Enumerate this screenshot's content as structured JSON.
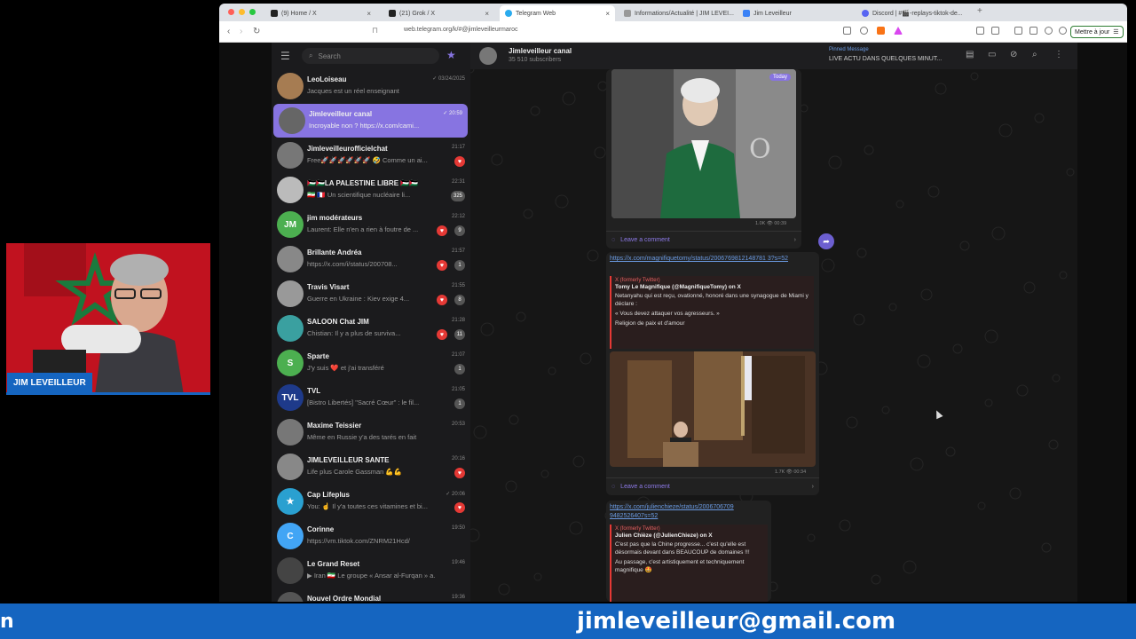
{
  "browser": {
    "tabs": [
      {
        "label": "(9) Home / X",
        "active": false
      },
      {
        "label": "(21) Grok / X",
        "active": false
      },
      {
        "label": "Telegram Web",
        "active": true
      },
      {
        "label": "Informations/Actualité | JIM LEVEI...",
        "active": false
      },
      {
        "label": "Jim Leveilleur",
        "active": false
      },
      {
        "label": "Discord | #🎬-replays-tiktok-de...",
        "active": false
      }
    ],
    "new_tab": "+",
    "url": "web.telegram.org/k/#@jimleveilleurmaroc",
    "update_label": "Mettre à jour"
  },
  "sidebar": {
    "search_placeholder": "Search",
    "chats": [
      {
        "name": "LeoLoiseau",
        "preview": "Jacques est un réel enseignant",
        "time": "✓ 03/24/2025",
        "badge": "",
        "heart": false,
        "avatar_color": "#a67c52",
        "avatar_letter": ""
      },
      {
        "name": "Jimleveilleur canal",
        "preview": "Incroyable non ? https://x.com/cami...",
        "time": "✓ 20:59",
        "badge": "",
        "heart": false,
        "avatar_color": "#666666",
        "avatar_letter": "",
        "active": true
      },
      {
        "name": "Jimleveilleurofficielchat",
        "preview": "Free🚀🚀🚀🚀🚀🚀 🤣 Comme un ai...",
        "time": "21:17",
        "badge": "",
        "heart": true,
        "avatar_color": "#777777",
        "avatar_letter": ""
      },
      {
        "name": "🇵🇸🇵🇸LA PALESTINE LIBRE 🇵🇸🇵🇸",
        "preview": "🇮🇷 🇫🇷 Un scientifique nucléaire li...",
        "time": "22:31",
        "badge": "325",
        "heart": false,
        "avatar_color": "#bbbbbb",
        "avatar_letter": ""
      },
      {
        "name": "jim modérateurs",
        "preview": "Laurent: Elle n'en a rien à foutre de ...",
        "time": "22:12",
        "badge": "9",
        "heart": true,
        "avatar_color": "#4caf50",
        "avatar_letter": "JM"
      },
      {
        "name": "Brillante Andréa",
        "preview": "https://x.com/i/status/200708...",
        "time": "21:57",
        "badge": "1",
        "heart": true,
        "avatar_color": "#888888",
        "avatar_letter": ""
      },
      {
        "name": "Travis Visart",
        "preview": "Guerre en Ukraine : Kiev exige 4...",
        "time": "21:55",
        "badge": "8",
        "heart": true,
        "avatar_color": "#999999",
        "avatar_letter": ""
      },
      {
        "name": "SALOON Chat JIM",
        "preview": "Chistian: Il y a plus de surviva...",
        "time": "21:28",
        "badge": "11",
        "heart": true,
        "avatar_color": "#3aa0a0",
        "avatar_letter": ""
      },
      {
        "name": "Sparte",
        "preview": "J'y suis ❤️ et j'ai transféré",
        "time": "21:07",
        "badge": "1",
        "heart": false,
        "avatar_color": "#4caf50",
        "avatar_letter": "S"
      },
      {
        "name": "TVL",
        "preview": "[Bistro Libertés] \"Sacré Cœur\" : le fil...",
        "time": "21:05",
        "badge": "1",
        "heart": false,
        "avatar_color": "#1e3a8a",
        "avatar_letter": "TVL"
      },
      {
        "name": "Maxime Teissier",
        "preview": "Même en Russie y'a des tarés en fait",
        "time": "20:53",
        "badge": "",
        "heart": false,
        "avatar_color": "#777777",
        "avatar_letter": ""
      },
      {
        "name": "JIMLEVEILLEUR SANTE",
        "preview": "Life plus Carole Gassman 💪💪",
        "time": "20:16",
        "badge": "",
        "heart": true,
        "avatar_color": "#888888",
        "avatar_letter": ""
      },
      {
        "name": "Cap Lifeplus",
        "preview": "You: ☝ Il y'a toutes ces vitamines et bi...",
        "time": "✓ 20:06",
        "badge": "",
        "heart": true,
        "avatar_color": "#2aa0d0",
        "avatar_letter": "★"
      },
      {
        "name": "Corinne",
        "preview": "https://vm.tiktok.com/ZNRM21Hcd/",
        "time": "19:50",
        "badge": "",
        "heart": false,
        "avatar_color": "#42a5f5",
        "avatar_letter": "C"
      },
      {
        "name": "Le Grand Reset",
        "preview": "▶ Iran 🇮🇷 Le groupe « Ansar al-Furqan » a...",
        "time": "19:46",
        "badge": "",
        "heart": false,
        "avatar_color": "#444444",
        "avatar_letter": ""
      },
      {
        "name": "Nouvel Ordre Mondial",
        "preview": "",
        "time": "19:36",
        "badge": "",
        "heart": false,
        "avatar_color": "#555555",
        "avatar_letter": ""
      }
    ]
  },
  "channel": {
    "title": "Jimleveilleur canal",
    "subscribers": "35 510 subscribers",
    "pinned_label": "Pinned Message",
    "pinned_text": "LIVE ACTU DANS QUELQUES MINUT..."
  },
  "messages": [
    {
      "badge": "Today",
      "views": "1.0K",
      "time": "00:39",
      "comment_label": "Leave a comment"
    },
    {
      "link": "https://x.com/magnifiquetomy/status/2006769812148781 3?s=52",
      "quote_source": "X (formerly Twitter)",
      "quote_title": "Tomy Le Magnifique (@MagnifiqueTomy) on X",
      "quote_body": "Netanyahu qui est reçu, ovationné, honoré dans une synagogue de Miami y déclare :",
      "quote_body2": "« Vous devez attaquer vos agresseurs. »",
      "quote_body3": "Religion de paix et d'amour",
      "views": "1.7K",
      "time": "00:34",
      "comment_label": "Leave a comment"
    },
    {
      "link": "https://x.com/julienchieze/status/2006706709 9482526407s=52",
      "quote_source": "X (formerly Twitter)",
      "quote_title": "Julien Chièze (@JulienChieze) on X",
      "quote_body": "C'est pas que la Chine progresse... c'est qu'elle est désormais devant dans BEAUCOUP de domaines !!!",
      "quote_body2": "Au passage, c'est artistiquement et techniquement magnifique 🤩"
    }
  ],
  "overlay": {
    "cam_name": "JIM LEVEILLEUR",
    "banner_left": "n",
    "banner_email": "jimleveilleur@gmail.com"
  },
  "colors": {
    "accent": "#8774e1",
    "banner": "#1565c0",
    "flag_red": "#c1121f",
    "flag_green": "#1b7a3d"
  }
}
